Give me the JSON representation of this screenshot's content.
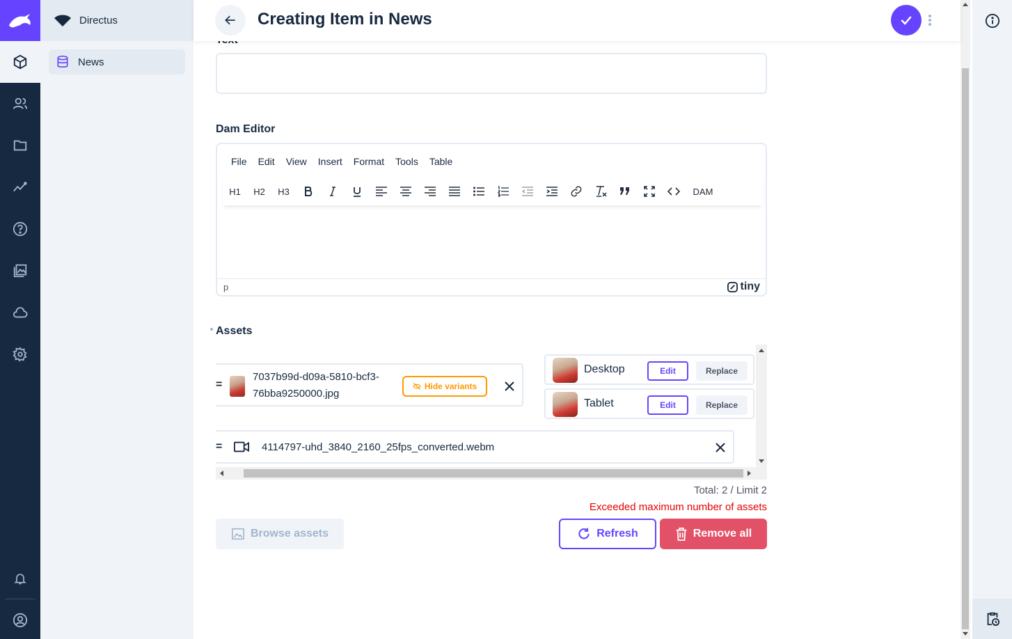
{
  "nav": {
    "project_name": "Directus",
    "items": [
      {
        "label": "News"
      }
    ]
  },
  "header": {
    "title": "Creating Item in News"
  },
  "form": {
    "text_field_label": "Text",
    "dam_editor_label": "Dam Editor",
    "editor": {
      "menu": [
        "File",
        "Edit",
        "View",
        "Insert",
        "Format",
        "Tools",
        "Table"
      ],
      "toolbar": {
        "h1": "H1",
        "h2": "H2",
        "h3": "H3",
        "dam": "DAM"
      },
      "status_path": "p",
      "brand": "tiny"
    },
    "assets_label": "Assets",
    "assets": [
      {
        "file_name_line1": "7037b99d-d09a-5810-bcf3-",
        "file_name_line2": "76bba9250000.jpg",
        "hide_variants_label": "Hide variants",
        "variants": [
          {
            "name": "Desktop",
            "edit_label": "Edit",
            "replace_label": "Replace"
          },
          {
            "name": "Tablet",
            "edit_label": "Edit",
            "replace_label": "Replace"
          }
        ]
      },
      {
        "file_name": "4114797-uhd_3840_2160_25fps_converted.webm"
      }
    ],
    "total_text": "Total: 2 / Limit 2",
    "error_text": "Exceeded maximum number of assets",
    "browse_label": "Browse assets",
    "refresh_label": "Refresh",
    "remove_all_label": "Remove all"
  },
  "colors": {
    "accent": "#6644ff",
    "danger": "#e35169",
    "warning": "#ff9900",
    "error_text": "#e60000",
    "nav_dark": "#172940"
  }
}
